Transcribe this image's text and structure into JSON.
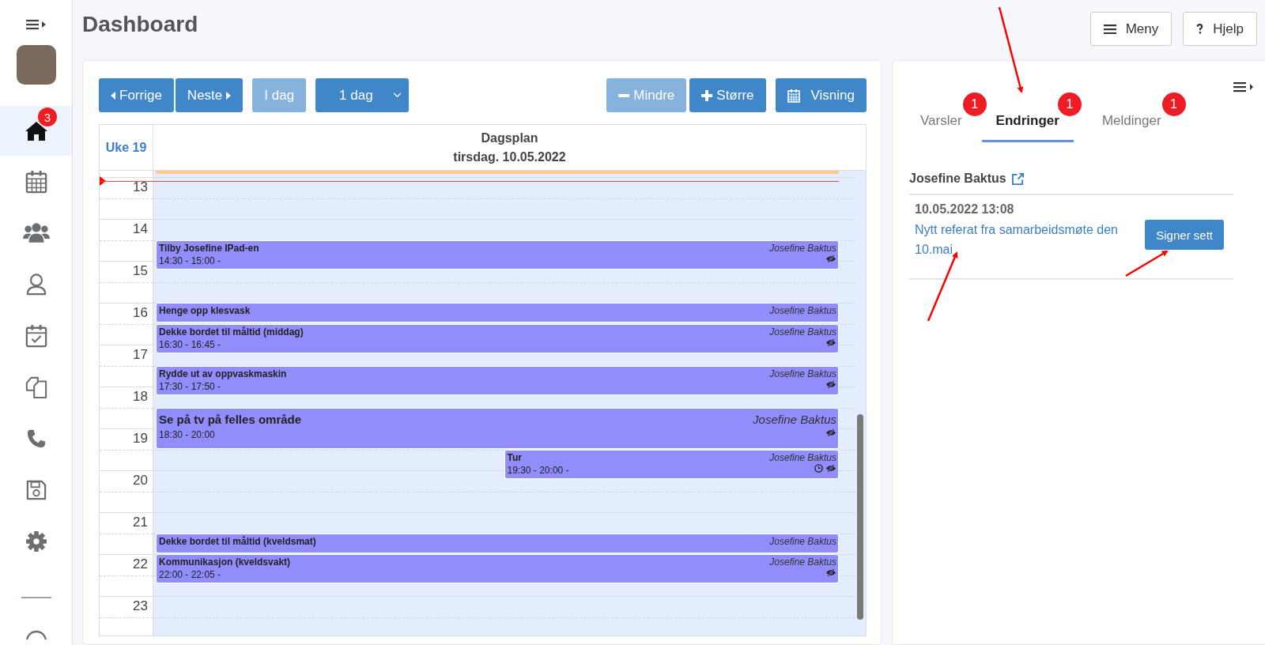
{
  "sidebar": {
    "items": [
      {
        "kind": "home",
        "selected": true,
        "badge": "3"
      },
      {
        "kind": "calendar",
        "selected": false
      },
      {
        "kind": "users",
        "selected": false
      },
      {
        "kind": "user",
        "selected": false
      },
      {
        "kind": "calendar-check",
        "selected": false
      },
      {
        "kind": "copies",
        "selected": false
      },
      {
        "kind": "phone",
        "selected": false
      },
      {
        "kind": "save",
        "selected": false
      },
      {
        "kind": "gear",
        "selected": false
      }
    ]
  },
  "header": {
    "title": "Dashboard",
    "buttons": [
      {
        "kind": "menu",
        "label": "Meny"
      },
      {
        "kind": "help",
        "label": "Hjelp"
      }
    ]
  },
  "toolbar": {
    "buttons": [
      {
        "kind": "prev",
        "label": "Forrige",
        "disabled": false
      },
      {
        "kind": "next",
        "label": "Neste",
        "disabled": false
      },
      {
        "kind": "plain",
        "label": "I dag",
        "disabled": true
      },
      {
        "kind": "dropdown",
        "label": "1 dag",
        "disabled": false
      },
      {
        "kind": "minus",
        "label": "Mindre",
        "disabled": true
      },
      {
        "kind": "plus",
        "label": "Større",
        "disabled": false
      },
      {
        "kind": "view",
        "label": "Visning",
        "disabled": false
      }
    ]
  },
  "calendar": {
    "week": "Uke 19",
    "title": "Dagsplan",
    "date": "tirsdag. 10.05.2022",
    "hours": [
      "13",
      "14",
      "15",
      "16",
      "17",
      "18",
      "19",
      "20",
      "21",
      "22",
      "23"
    ],
    "events": [
      {
        "kind": "normal",
        "title": "Tilby Josefine IPad-en",
        "time": "14:30 - 15:00  -",
        "owner": "Josefine Baktus",
        "reminder": false
      },
      {
        "kind": "normal",
        "title": "Henge opp klesvask",
        "owner": "Josefine Baktus"
      },
      {
        "kind": "normal",
        "title": "Dekke bordet til måltid (middag)",
        "time": "16:30 - 16:45  -",
        "owner": "Josefine Baktus",
        "reminder": false
      },
      {
        "kind": "normal",
        "title": "Rydde ut av oppvaskmaskin",
        "time": "17:30 - 17:50  -",
        "owner": "Josefine Baktus",
        "reminder": false
      },
      {
        "kind": "large",
        "title": "Se på tv på felles område",
        "time": "18:30 - 20:00",
        "owner": "Josefine Baktus",
        "reminder": false
      },
      {
        "kind": "normal",
        "title": "Tur",
        "time": "19:30 - 20:00  -",
        "owner": "Josefine Baktus",
        "reminder": true
      },
      {
        "kind": "normal",
        "title": "Dekke bordet til måltid (kveldsmat)",
        "owner": "Josefine Baktus"
      },
      {
        "kind": "normal",
        "title": "Kommunikasjon (kveldsvakt)",
        "time": "22:00 - 22:05  -",
        "owner": "Josefine Baktus",
        "reminder": false
      }
    ]
  },
  "panel": {
    "tabs": [
      {
        "label": "Varsler",
        "badge": "1",
        "selected": false
      },
      {
        "label": "Endringer",
        "badge": "1",
        "selected": true
      },
      {
        "label": "Meldinger",
        "badge": "1",
        "selected": false
      }
    ],
    "person": "Josefine Baktus",
    "entries": [
      {
        "timestamp": "10.05.2022 13:08",
        "text": "Nytt referat fra samarbeidsmøte den 10.mai",
        "action": "Signer sett"
      }
    ]
  }
}
